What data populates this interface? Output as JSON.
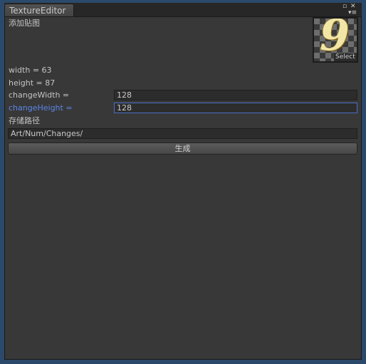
{
  "window": {
    "tab_title": "TextureEditor",
    "controls": {
      "maximize": "▫",
      "close": "✕",
      "menu": "▾≡"
    }
  },
  "editor": {
    "add_texture_label": "添加贴图",
    "texture_select_label": "Select",
    "texture_preview_glyph": "9",
    "width_label": "width = 63",
    "height_label": "height = 87",
    "change_width_label": "changeWidth =",
    "change_width_value": "128",
    "change_height_label": "changeHeight =",
    "change_height_value": "128",
    "save_path_label": "存储路径",
    "save_path_value": "Art/Num/Changes/",
    "generate_button": "生成"
  },
  "colors": {
    "focus_accent": "#5b86e6",
    "panel_background": "#383838",
    "frame_blue": "#2b4a6b"
  }
}
